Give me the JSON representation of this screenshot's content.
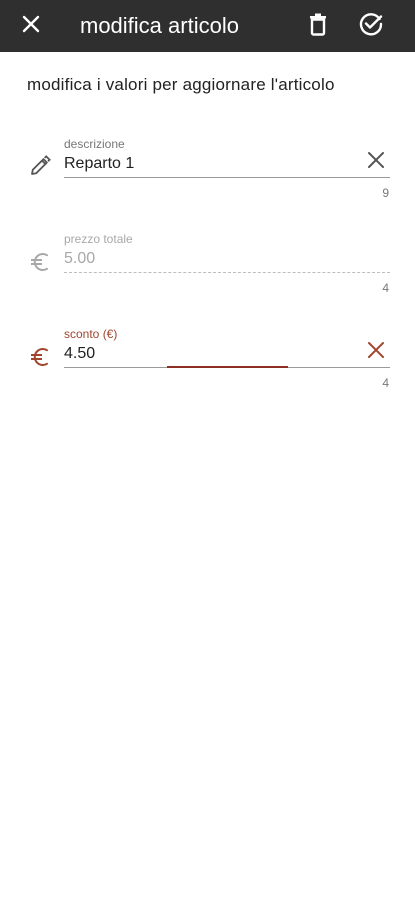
{
  "toolbar": {
    "title": "modifica articolo",
    "close_icon": "close-icon",
    "delete_icon": "trash-icon",
    "confirm_icon": "check-circle-icon",
    "background": "#2f2f2f"
  },
  "subtitle": "modifica i valori per aggiornare l'articolo",
  "fields": [
    {
      "label": "descrizione",
      "value": "Reparto 1",
      "counter": "9",
      "icon": "pencil-icon",
      "clear_icon": "close-icon",
      "state": "normal"
    },
    {
      "label": "prezzo totale",
      "value": "5.00",
      "counter": "4",
      "icon": "euro-icon",
      "state": "disabled"
    },
    {
      "label": "sconto (€)",
      "value": "4.50",
      "counter": "4",
      "icon": "euro-icon",
      "clear_icon": "close-icon",
      "state": "focused"
    }
  ],
  "colors": {
    "accent": "#a0462f",
    "focus_line": "#8d2e25",
    "disabled": "#a8a8a8"
  }
}
